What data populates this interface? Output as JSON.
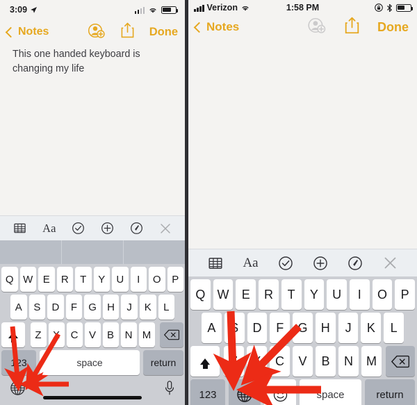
{
  "meta": {
    "accent_gold": "#e6a820",
    "arrow_red": "#ec2b16",
    "keyboard_bg": "#ccced3",
    "key_white": "#ffffff",
    "key_dark": "#adb2bb",
    "toolbar_bg": "#eceff2",
    "prediction_bg": "#b9bec6",
    "note_paper": "#f4f3f1"
  },
  "left_panel": {
    "status": {
      "time": "3:09",
      "location_icon": "location-arrow-icon",
      "signal_icon": "cellular-signal-icon",
      "wifi_icon": "wifi-icon",
      "battery_icon": "battery-icon",
      "battery_level_pct": 62
    },
    "nav": {
      "back_label": "Notes",
      "back_icon": "chevron-left-icon",
      "add_person_icon": "add-person-icon",
      "share_icon": "share-icon",
      "done_label": "Done"
    },
    "note": {
      "text": "This one handed keyboard is changing my life"
    },
    "toolbar": {
      "items": [
        {
          "icon": "table-icon",
          "label": ""
        },
        {
          "icon": "text-format-icon",
          "label": "Aa"
        },
        {
          "icon": "checklist-icon",
          "label": ""
        },
        {
          "icon": "add-attachment-icon",
          "label": ""
        },
        {
          "icon": "markup-pen-icon",
          "label": ""
        },
        {
          "icon": "close-icon",
          "label": ""
        }
      ]
    },
    "prediction_bar": {
      "suggestions": [
        "",
        "",
        ""
      ]
    },
    "keyboard": {
      "row1": [
        "Q",
        "W",
        "E",
        "R",
        "T",
        "Y",
        "U",
        "I",
        "O",
        "P"
      ],
      "row2": [
        "A",
        "S",
        "D",
        "F",
        "G",
        "H",
        "J",
        "K",
        "L"
      ],
      "row3": [
        "Z",
        "X",
        "C",
        "V",
        "B",
        "N",
        "M"
      ],
      "shift_icon": "shift-icon",
      "delete_icon": "delete-backspace-icon",
      "numbers_label": "123",
      "space_label": "space",
      "return_label": "return",
      "globe_icon": "globe-icon",
      "dictation_icon": "microphone-icon",
      "home_indicator": "home-indicator"
    }
  },
  "right_panel": {
    "status": {
      "carrier": "Verizon",
      "time": "1:58 PM",
      "signal_icon": "cellular-signal-icon",
      "wifi_icon": "wifi-icon",
      "rotation_lock_icon": "rotation-lock-icon",
      "bluetooth_icon": "bluetooth-icon",
      "battery_icon": "battery-icon",
      "battery_level_pct": 52
    },
    "nav": {
      "back_label": "Notes",
      "back_icon": "chevron-left-icon",
      "add_person_icon": "add-person-icon",
      "share_icon": "share-icon",
      "done_label": "Done"
    },
    "note": {
      "text": ""
    },
    "toolbar": {
      "items": [
        {
          "icon": "table-icon",
          "label": ""
        },
        {
          "icon": "text-format-icon",
          "label": "Aa"
        },
        {
          "icon": "checklist-icon",
          "label": ""
        },
        {
          "icon": "add-attachment-icon",
          "label": ""
        },
        {
          "icon": "markup-pen-icon",
          "label": ""
        },
        {
          "icon": "close-icon",
          "label": ""
        }
      ]
    },
    "keyboard": {
      "row1": [
        "Q",
        "W",
        "E",
        "R",
        "T",
        "Y",
        "U",
        "I",
        "O",
        "P"
      ],
      "row2": [
        "A",
        "S",
        "D",
        "F",
        "G",
        "H",
        "J",
        "K",
        "L"
      ],
      "row3": [
        "Z",
        "X",
        "C",
        "V",
        "B",
        "N",
        "M"
      ],
      "shift_icon": "shift-icon",
      "delete_icon": "delete-backspace-icon",
      "numbers_label": "123",
      "globe_icon": "globe-icon",
      "emoji_icon": "emoji-icon",
      "space_label": "space",
      "return_label": "return"
    }
  },
  "annotations": {
    "arrows": [
      {
        "name": "arrow-left-shift-to-globe",
        "target": "globe-icon"
      },
      {
        "name": "arrow-left-diagonal-to-globe",
        "target": "globe-icon"
      },
      {
        "name": "arrow-left-horizontal-to-globe",
        "target": "globe-icon"
      },
      {
        "name": "arrow-right-vertical-to-globe",
        "target": "globe-icon"
      },
      {
        "name": "arrow-right-diagonal-to-globe",
        "target": "globe-icon"
      },
      {
        "name": "arrow-right-horizontal-to-globe",
        "target": "globe-icon"
      }
    ]
  }
}
